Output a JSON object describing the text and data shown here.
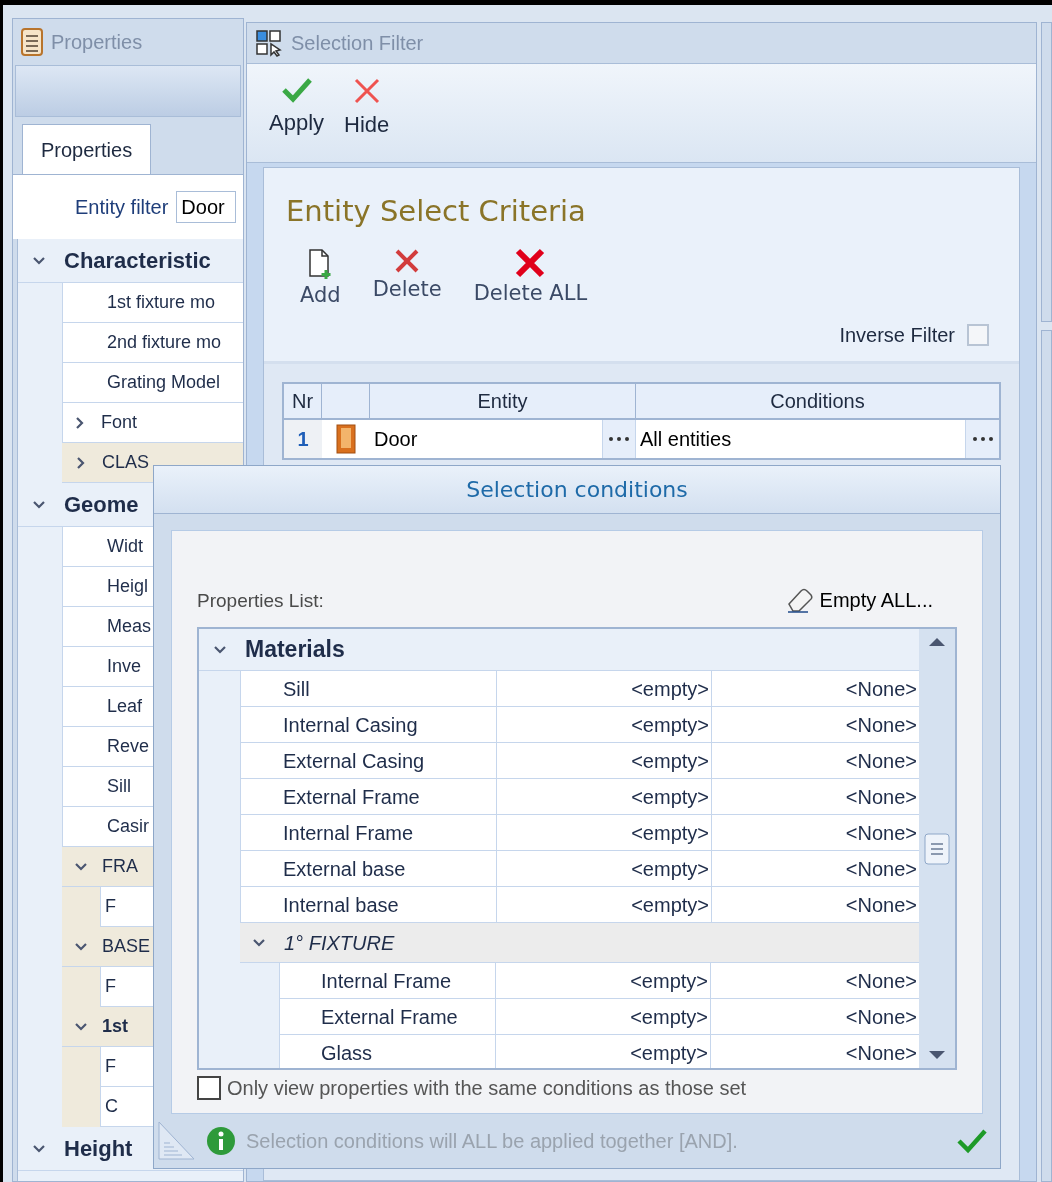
{
  "properties_panel": {
    "title": "Properties",
    "tabs": [
      {
        "label": "Properties",
        "selected": true
      }
    ],
    "entity_filter": {
      "label": "Entity filter",
      "value": "Door"
    },
    "tree": [
      {
        "label": "Characteristic",
        "expanded": true,
        "children": [
          {
            "label": "1st fixture mo",
            "kind": "property"
          },
          {
            "label": "2nd fixture mo",
            "kind": "property"
          },
          {
            "label": "Grating Model",
            "kind": "property"
          },
          {
            "label": "Font",
            "kind": "property",
            "expanded": false
          },
          {
            "label": "CLAS",
            "kind": "section",
            "expanded": false,
            "bold": false
          }
        ]
      },
      {
        "label": "Geome",
        "expanded": true,
        "children": [
          {
            "label": "Widt",
            "kind": "property"
          },
          {
            "label": "Heigl",
            "kind": "property"
          },
          {
            "label": "Meas",
            "kind": "property"
          },
          {
            "label": "Inve",
            "kind": "property"
          },
          {
            "label": "Leaf",
            "kind": "property"
          },
          {
            "label": "Reve",
            "kind": "property"
          },
          {
            "label": "Sill",
            "kind": "property"
          },
          {
            "label": "Casir",
            "kind": "property"
          },
          {
            "label": "FRA",
            "kind": "section",
            "expanded": true,
            "bold": false,
            "children": [
              {
                "label": "F",
                "kind": "property"
              }
            ]
          },
          {
            "label": "BASE",
            "kind": "section",
            "expanded": true,
            "bold": false,
            "children": [
              {
                "label": "F",
                "kind": "property"
              }
            ]
          },
          {
            "label": "1st",
            "kind": "section",
            "expanded": true,
            "bold": true,
            "children": [
              {
                "label": "F",
                "kind": "property"
              },
              {
                "label": "C",
                "kind": "property"
              }
            ]
          }
        ]
      },
      {
        "label": "Height",
        "expanded": true
      }
    ]
  },
  "selection_filter": {
    "title": "Selection Filter",
    "toolbar": [
      {
        "label": "Apply",
        "kind": "apply"
      },
      {
        "label": "Hide",
        "kind": "hide"
      }
    ],
    "criteria": {
      "title": "Entity Select Criteria",
      "actions": [
        {
          "label": "Add",
          "kind": "add"
        },
        {
          "label": "Delete",
          "kind": "delete"
        },
        {
          "label": "Delete ALL",
          "kind": "delete_all"
        }
      ],
      "inverse_filter": {
        "label": "Inverse Filter",
        "checked": false
      },
      "table": {
        "columns": [
          "Nr",
          "Entity",
          "Conditions"
        ],
        "rows": [
          {
            "nr": "1",
            "entity": "Door",
            "conditions": "All entities"
          }
        ]
      }
    }
  },
  "dialog": {
    "title": "Selection conditions",
    "list_label": "Properties List:",
    "empty_all": "Empty ALL...",
    "groups": [
      {
        "label": "Materials",
        "expanded": true,
        "rows": [
          {
            "name": "Sill",
            "value": "<empty>",
            "condition": "<None>"
          },
          {
            "name": "Internal Casing",
            "value": "<empty>",
            "condition": "<None>"
          },
          {
            "name": "External Casing",
            "value": "<empty>",
            "condition": "<None>"
          },
          {
            "name": "External Frame",
            "value": "<empty>",
            "condition": "<None>"
          },
          {
            "name": "Internal Frame",
            "value": "<empty>",
            "condition": "<None>"
          },
          {
            "name": "External base",
            "value": "<empty>",
            "condition": "<None>"
          },
          {
            "name": "Internal base",
            "value": "<empty>",
            "condition": "<None>"
          }
        ],
        "subgroups": [
          {
            "label": "1° FIXTURE",
            "expanded": true,
            "rows": [
              {
                "name": "Internal Frame",
                "value": "<empty>",
                "condition": "<None>"
              },
              {
                "name": "External Frame",
                "value": "<empty>",
                "condition": "<None>"
              },
              {
                "name": "Glass",
                "value": "<empty>",
                "condition": "<None>"
              }
            ]
          }
        ]
      }
    ],
    "only_same": {
      "label": "Only view properties with the same conditions as those set",
      "checked": false
    },
    "status": "Selection conditions will ALL be applied together [AND]."
  }
}
